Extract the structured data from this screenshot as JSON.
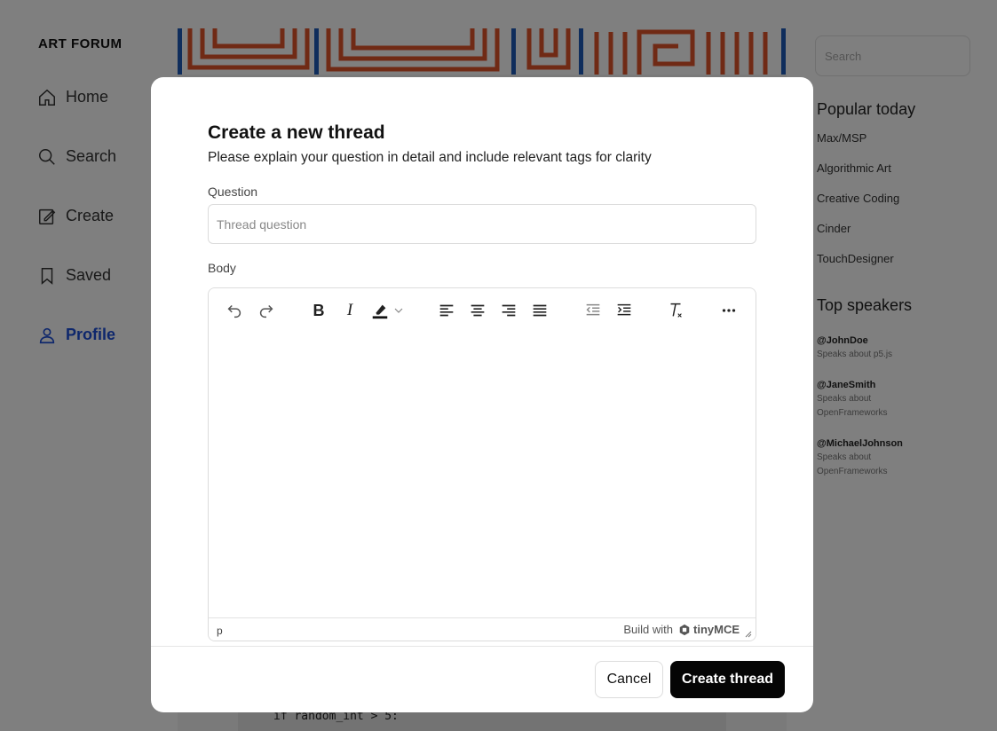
{
  "app": {
    "logo": "ART FORUM",
    "nav": [
      {
        "label": "Home",
        "icon": "home-icon"
      },
      {
        "label": "Search",
        "icon": "search-icon"
      },
      {
        "label": "Create",
        "icon": "create-icon"
      },
      {
        "label": "Saved",
        "icon": "bookmark-icon"
      },
      {
        "label": "Profile",
        "icon": "user-icon",
        "active": true
      }
    ],
    "search_placeholder": "Search",
    "popular_title": "Popular today",
    "popular": [
      "Max/MSP",
      "Algorithmic Art",
      "Creative Coding",
      "Cinder",
      "TouchDesigner"
    ],
    "speakers_title": "Top speakers",
    "speakers": [
      {
        "name": "@JohnDoe",
        "desc": "Speaks about p5.js"
      },
      {
        "name": "@JaneSmith",
        "desc": "Speaks about OpenFrameworks"
      },
      {
        "name": "@MichaelJohnson",
        "desc": "Speaks about OpenFrameworks"
      }
    ],
    "code_snippet": "if random_int > 5:",
    "accent_color": "#1d4ed8"
  },
  "modal": {
    "title": "Create a new thread",
    "subtitle": "Please explain your question in detail and include relevant tags for clarity",
    "question_label": "Question",
    "question_placeholder": "Thread question",
    "question_value": "",
    "body_label": "Body",
    "toolbar": [
      "undo-icon",
      "redo-icon",
      "bold-icon",
      "italic-icon",
      "highlight-icon",
      "chevron-down-icon",
      "align-left-icon",
      "align-center-icon",
      "align-right-icon",
      "align-justify-icon",
      "outdent-icon",
      "indent-icon",
      "clear-format-icon",
      "more-icon"
    ],
    "bold_glyph": "B",
    "italic_glyph": "I",
    "status_path": "p",
    "build_with": "Build with",
    "brand": "tinyMCE",
    "cancel_label": "Cancel",
    "create_label": "Create thread",
    "create_bg": "#050505"
  }
}
